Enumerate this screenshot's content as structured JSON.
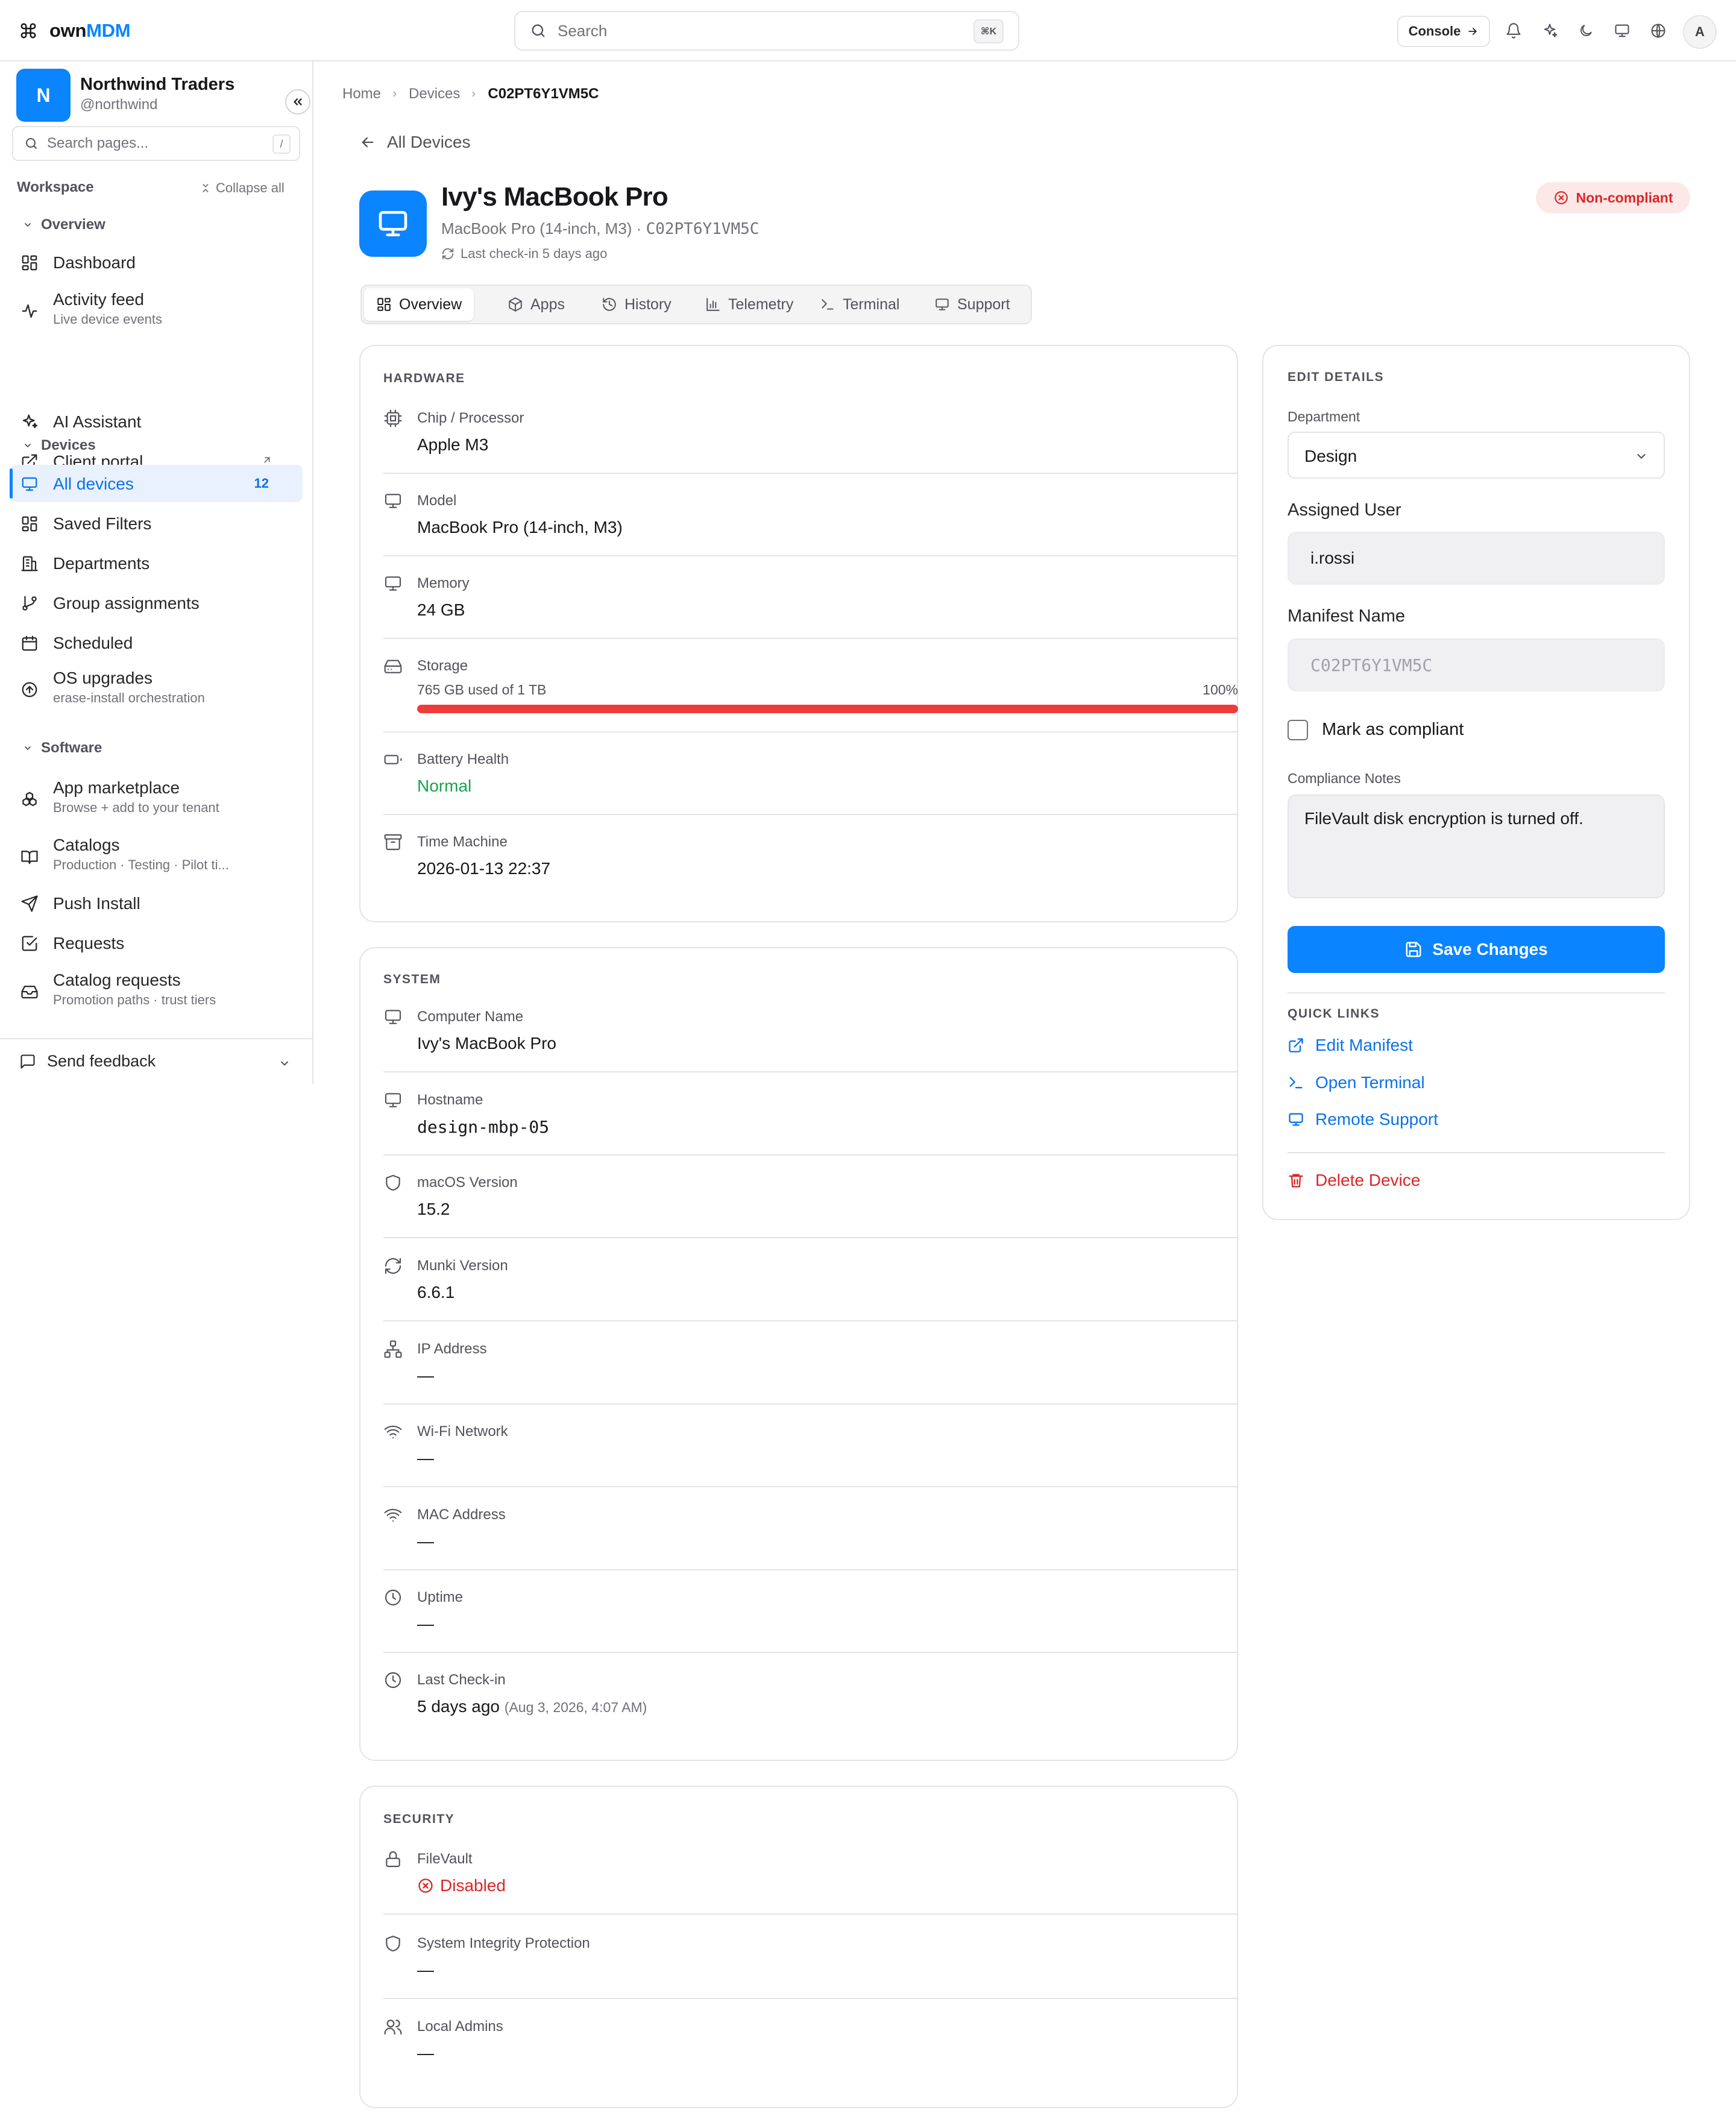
{
  "app": {
    "logo_prefix": "own",
    "logo_suffix": "MDM"
  },
  "topbar": {
    "search_placeholder": "Search",
    "search_kbd": "⌘K",
    "console_label": "Console",
    "avatar_initial": "A"
  },
  "sidebar": {
    "org_initial": "N",
    "org_name": "Northwind Traders",
    "org_handle": "@northwind",
    "search_placeholder": "Search pages...",
    "search_kbd": "/",
    "workspace_label": "Workspace",
    "collapse_all_label": "Collapse all",
    "groups": {
      "overview": "Overview",
      "devices": "Devices",
      "software": "Software"
    },
    "items": {
      "dashboard": {
        "label": "Dashboard"
      },
      "activity": {
        "label": "Activity feed",
        "sub": "Live device events"
      },
      "ai": {
        "label": "AI Assistant"
      },
      "portal": {
        "label": "Client portal"
      },
      "all_devices": {
        "label": "All devices",
        "count": "12"
      },
      "saved_filters": {
        "label": "Saved Filters"
      },
      "departments": {
        "label": "Departments"
      },
      "group_assignments": {
        "label": "Group assignments"
      },
      "scheduled": {
        "label": "Scheduled"
      },
      "os_upgrades": {
        "label": "OS upgrades",
        "sub": "erase-install orchestration"
      },
      "app_marketplace": {
        "label": "App marketplace",
        "sub": "Browse + add to your tenant"
      },
      "catalogs": {
        "label": "Catalogs",
        "sub": "Production · Testing · Pilot ti..."
      },
      "push_install": {
        "label": "Push Install"
      },
      "requests": {
        "label": "Requests"
      },
      "catalog_requests": {
        "label": "Catalog requests",
        "sub": "Promotion paths · trust tiers"
      }
    },
    "feedback_label": "Send feedback"
  },
  "breadcrumb": {
    "home": "Home",
    "devices": "Devices",
    "current": "C02PT6Y1VM5C"
  },
  "back_label": "All Devices",
  "device": {
    "name": "Ivy's MacBook Pro",
    "model_line": "MacBook Pro (14-inch, M3) · ",
    "serial": "C02PT6Y1VM5C",
    "last_checkin": "Last check-in 5 days ago",
    "status": "Non-compliant"
  },
  "tabs": [
    "Overview",
    "Apps",
    "History",
    "Telemetry",
    "Terminal",
    "Support"
  ],
  "hardware": {
    "title": "HARDWARE",
    "chip": {
      "label": "Chip / Processor",
      "value": "Apple M3"
    },
    "model": {
      "label": "Model",
      "value": "MacBook Pro (14-inch, M3)"
    },
    "memory": {
      "label": "Memory",
      "value": "24 GB"
    },
    "storage": {
      "label": "Storage",
      "used_text": "765 GB used of 1 TB",
      "percent_text": "100%",
      "fill_percent": 100
    },
    "battery": {
      "label": "Battery Health",
      "value": "Normal"
    },
    "time_machine": {
      "label": "Time Machine",
      "value": "2026-01-13 22:37"
    }
  },
  "system": {
    "title": "SYSTEM",
    "computer_name": {
      "label": "Computer Name",
      "value": "Ivy's MacBook Pro"
    },
    "hostname": {
      "label": "Hostname",
      "value": "design-mbp-05"
    },
    "macos": {
      "label": "macOS Version",
      "value": "15.2"
    },
    "munki": {
      "label": "Munki Version",
      "value": "6.6.1"
    },
    "ip": {
      "label": "IP Address",
      "value": "—"
    },
    "wifi": {
      "label": "Wi-Fi Network",
      "value": "—"
    },
    "mac": {
      "label": "MAC Address",
      "value": "—"
    },
    "uptime": {
      "label": "Uptime",
      "value": "—"
    },
    "last_checkin": {
      "label": "Last Check-in",
      "value": "5 days ago",
      "detail": "(Aug 3, 2026, 4:07 AM)"
    }
  },
  "security": {
    "title": "SECURITY",
    "filevault": {
      "label": "FileVault",
      "value": "Disabled"
    },
    "sip": {
      "label": "System Integrity Protection",
      "value": "—"
    },
    "admins": {
      "label": "Local Admins",
      "value": "—"
    }
  },
  "edit": {
    "title": "EDIT DETAILS",
    "department_label": "Department",
    "department_value": "Design",
    "assigned_user_label": "Assigned User",
    "assigned_user_value": "i.rossi",
    "manifest_label": "Manifest Name",
    "manifest_value": "C02PT6Y1VM5C",
    "compliant_label": "Mark as compliant",
    "notes_label": "Compliance Notes",
    "notes_value": "FileVault disk encryption is turned off.",
    "save_label": "Save Changes",
    "quick_links_title": "QUICK LINKS",
    "edit_manifest": "Edit Manifest",
    "open_terminal": "Open Terminal",
    "remote_support": "Remote Support",
    "delete_device": "Delete Device"
  },
  "colors": {
    "accent": "#0a84ff",
    "danger": "#dc2626",
    "success": "#16a34a"
  }
}
